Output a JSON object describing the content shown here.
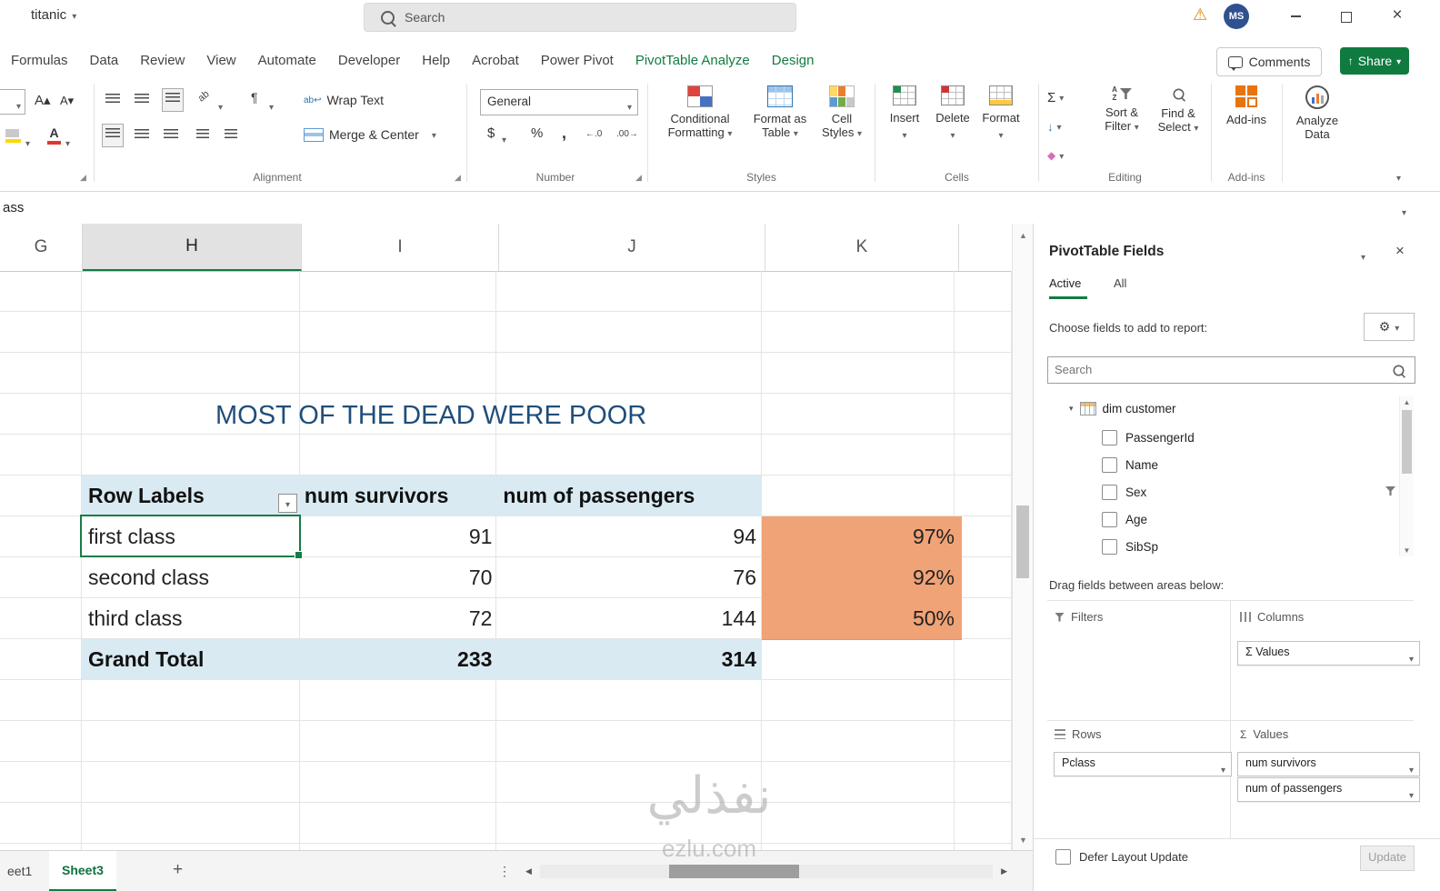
{
  "icons": {
    "chevron_down": "▾",
    "warning": "⚠",
    "close": "×",
    "sigma": "Σ",
    "pilcrow": "¶",
    "dollar": "$",
    "percent": "%",
    "comma": ",",
    "inc_decimal": "←.0",
    "dec_decimal": ".00→",
    "ellipsis": "⋮",
    "gear": "⚙",
    "up": "▲",
    "down": "▼",
    "left": "◀",
    "right": "▶",
    "plus": "+",
    "wrap_ab": "ab↩",
    "orient_ab": "ab",
    "share_arrow": "↑",
    "font_bigger": "A▴",
    "font_smaller": "A▾",
    "font_a": "A",
    "collapse_tri": "◢"
  },
  "titlebar": {
    "workbook": "titanic",
    "search_placeholder": "Search",
    "avatar_initials": "MS"
  },
  "ribbon_tabs": {
    "items": [
      {
        "label": "Formulas"
      },
      {
        "label": "Data"
      },
      {
        "label": "Review"
      },
      {
        "label": "View"
      },
      {
        "label": "Automate"
      },
      {
        "label": "Developer"
      },
      {
        "label": "Help"
      },
      {
        "label": "Acrobat"
      },
      {
        "label": "Power Pivot"
      },
      {
        "label": "PivotTable Analyze"
      },
      {
        "label": "Design"
      }
    ],
    "comments_label": "Comments",
    "share_label": "Share"
  },
  "ribbon": {
    "wrap_text_label": "Wrap Text",
    "merge_center_label": "Merge & Center",
    "number_format_value": "General",
    "conditional_line1": "Conditional",
    "conditional_line2": "Formatting",
    "format_table_line1": "Format as",
    "format_table_line2": "Table",
    "cell_styles_line1": "Cell",
    "cell_styles_line2": "Styles",
    "insert_label": "Insert",
    "delete_label": "Delete",
    "format_label": "Format",
    "sort_line1": "Sort &",
    "sort_line2": "Filter",
    "find_line1": "Find &",
    "find_line2": "Select",
    "addins_label": "Add-ins",
    "analyze_line1": "Analyze",
    "analyze_line2": "Data",
    "group_labels": {
      "alignment": "Alignment",
      "number": "Number",
      "styles": "Styles",
      "cells": "Cells",
      "editing": "Editing",
      "addins": "Add-ins"
    }
  },
  "formula_bar": {
    "visible_text": "ass"
  },
  "sheet": {
    "column_headers": [
      "G",
      "H",
      "I",
      "J",
      "K"
    ],
    "title": "MOST OF THE DEAD WERE POOR",
    "pivot": {
      "headers": [
        "Row Labels",
        "num survivors",
        "num of passengers"
      ],
      "rows": [
        {
          "label": "first class",
          "survivors": "91",
          "passengers": "94",
          "rate": "97%"
        },
        {
          "label": "second class",
          "survivors": "70",
          "passengers": "76",
          "rate": "92%"
        },
        {
          "label": "third class",
          "survivors": "72",
          "passengers": "144",
          "rate": "50%"
        }
      ],
      "grand_total": {
        "label": "Grand Total",
        "survivors": "233",
        "passengers": "314"
      }
    }
  },
  "watermark": {
    "line1": "نفذلي",
    "line2": "ezlu.com"
  },
  "tabs_bar": {
    "sheet1": "eet1",
    "sheet3": "Sheet3"
  },
  "fields_panel": {
    "title": "PivotTable Fields",
    "tab_active": "Active",
    "tab_all": "All",
    "choose_label": "Choose fields to add to report:",
    "search_placeholder": "Search",
    "table_name": "dim customer",
    "fields": [
      "PassengerId",
      "Name",
      "Sex",
      "Age",
      "SibSp"
    ],
    "drag_label": "Drag fields between areas below:",
    "filters_label": "Filters",
    "columns_label": "Columns",
    "rows_label": "Rows",
    "values_label": "Values",
    "columns_items": [
      "Σ Values"
    ],
    "rows_items": [
      "Pclass"
    ],
    "values_items": [
      "num survivors",
      "num of passengers"
    ],
    "defer_label": "Defer Layout Update",
    "update_label": "Update"
  }
}
